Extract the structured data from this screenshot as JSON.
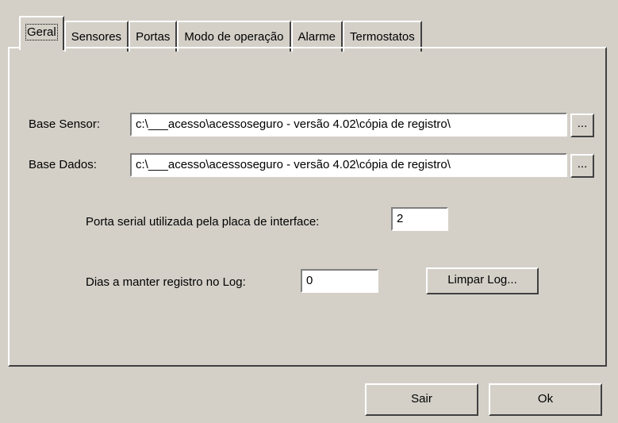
{
  "tabs": [
    {
      "label": "Geral",
      "selected": true
    },
    {
      "label": "Sensores",
      "selected": false
    },
    {
      "label": "Portas",
      "selected": false
    },
    {
      "label": "Modo de operação",
      "selected": false
    },
    {
      "label": "Alarme",
      "selected": false
    },
    {
      "label": "Termostatos",
      "selected": false
    }
  ],
  "geral": {
    "base_sensor_label": "Base Sensor:",
    "base_sensor_value": "c:\\___acesso\\acessoseguro - versão 4.02\\cópia de registro\\",
    "base_dados_label": "Base Dados:",
    "base_dados_value": "c:\\___acesso\\acessoseguro - versão 4.02\\cópia de registro\\",
    "browse_label": "...",
    "porta_serial_label": "Porta serial utilizada pela placa de interface:",
    "porta_serial_value": "2",
    "dias_log_label": "Dias a manter registro no Log:",
    "dias_log_value": "0",
    "limpar_log_label": "Limpar Log..."
  },
  "footer": {
    "sair_label": "Sair",
    "ok_label": "Ok"
  }
}
